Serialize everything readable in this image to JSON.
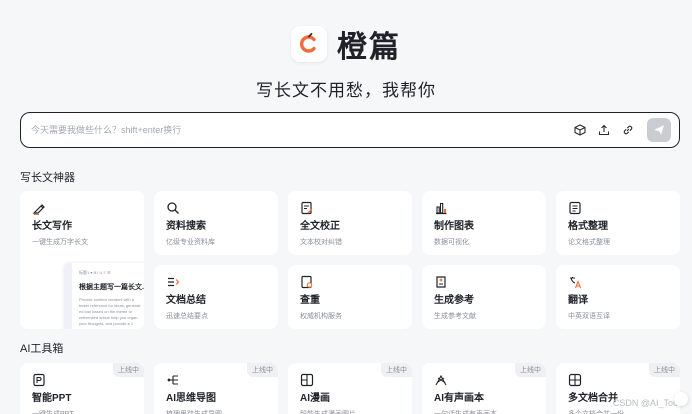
{
  "brand": {
    "name": "橙篇",
    "accent": "#f26b3a"
  },
  "tagline": "写长文不用愁，我帮你",
  "search": {
    "placeholder": "今天需要我做些什么？shift+enter换行",
    "value": ""
  },
  "toolbar_icons": [
    "cube-icon",
    "upload-icon",
    "link-icon",
    "send-icon"
  ],
  "sections": {
    "writing": {
      "title": "写长文神器",
      "cards": [
        {
          "icon": "pen-icon",
          "title": "长文写作",
          "desc": "一键生成万字长文"
        },
        {
          "icon": "search-icon",
          "title": "资料搜索",
          "desc": "亿级专业资料库"
        },
        {
          "icon": "edit-doc-icon",
          "title": "全文校正",
          "desc": "文本校对纠错"
        },
        {
          "icon": "chart-icon",
          "title": "制作图表",
          "desc": "数据可视化"
        },
        {
          "icon": "format-icon",
          "title": "格式整理",
          "desc": "论文格式整理"
        },
        {
          "icon": "list-icon",
          "title": "文档总结",
          "desc": "迅速总结要点"
        },
        {
          "icon": "check-doc-icon",
          "title": "查重",
          "desc": "权威机构服务"
        },
        {
          "icon": "reference-icon",
          "title": "生成参考",
          "desc": "生成参考文献"
        },
        {
          "icon": "translate-icon",
          "title": "翻译",
          "desc": "中英双语互译"
        }
      ],
      "preview": {
        "toolbar": "标题1 ▾  B  I  U  ≡  ☰",
        "heading": "根据主题写一篇长文...",
        "lines": [
          "Provide content creators with a",
          "better reference for ideas, generati",
          "ed tool based on the theme to",
          "referenced article help you organ",
          "your thoughts, and provide a 1"
        ]
      }
    },
    "ai_tools": {
      "title": "AI工具箱",
      "cards": [
        {
          "icon": "ppt-icon",
          "title": "智能PPT",
          "desc": "一键生成PPT",
          "badge": "上线中"
        },
        {
          "icon": "mindmap-icon",
          "title": "AI思维导图",
          "desc": "梳理思路生成导图",
          "badge": "上线中"
        },
        {
          "icon": "comic-icon",
          "title": "AI漫画",
          "desc": "智能生成漫画图片",
          "badge": "上线中"
        },
        {
          "icon": "audiobook-icon",
          "title": "AI有声画本",
          "desc": "一句话生成有声画本",
          "badge": "上线中"
        },
        {
          "icon": "merge-icon",
          "title": "多文档合并",
          "desc": "多个文档合并一份",
          "badge": "上线中"
        }
      ]
    }
  },
  "watermark": "CSDN @AI_Too"
}
